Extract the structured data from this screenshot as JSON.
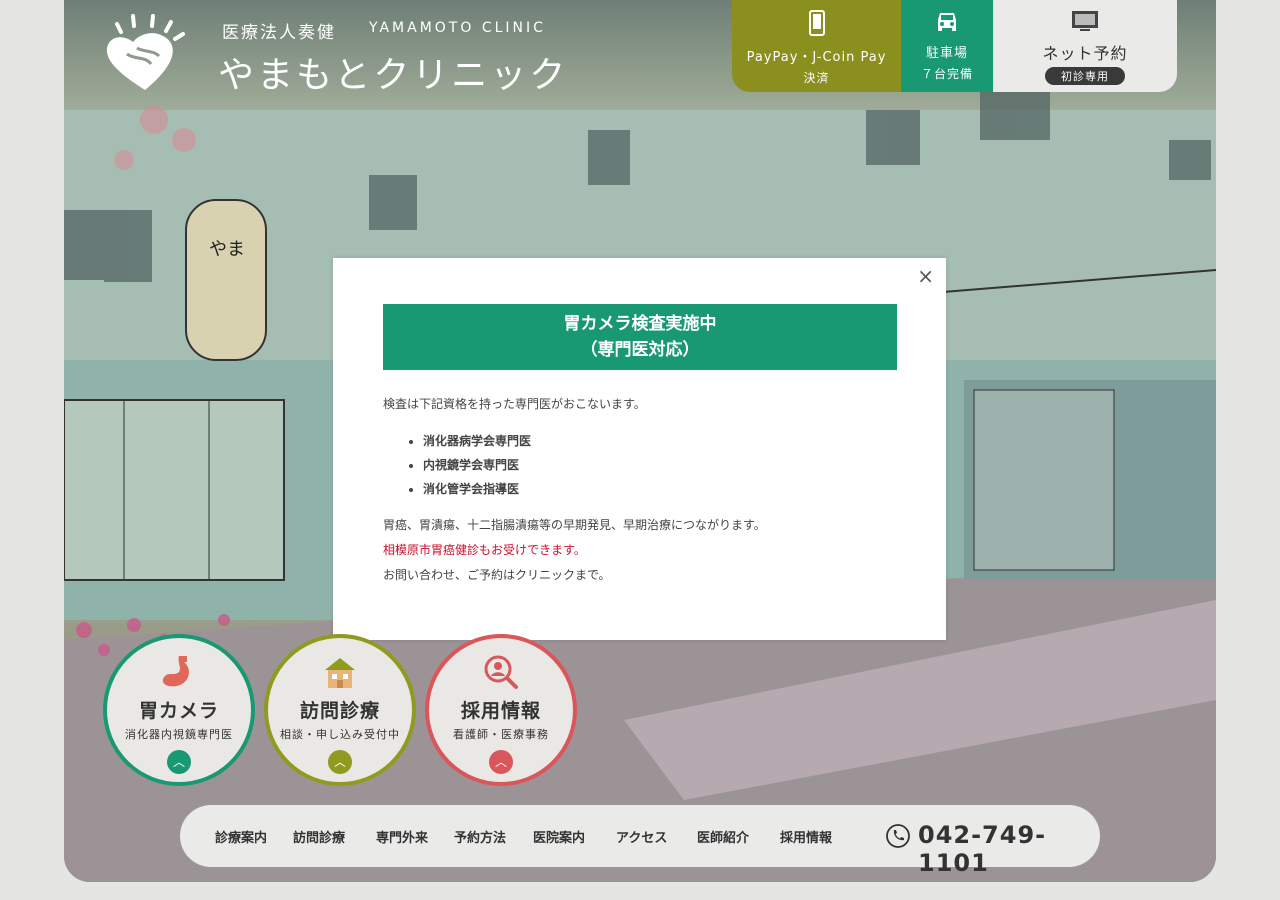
{
  "header": {
    "corp_name": "医療法人奏健",
    "corp_name_en": "YAMAMOTO CLINIC",
    "clinic_name": "やまもとクリニック"
  },
  "top_buttons": {
    "payment": {
      "label": "PayPay・J-Coin Pay",
      "sub": "決済"
    },
    "parking": {
      "label": "駐車場",
      "sub": "７台完備"
    },
    "web_reserve": {
      "label": "ネット予約",
      "badge": "初診専用"
    }
  },
  "modal": {
    "close": "×",
    "title_line1": "胃カメラ検査実施中",
    "title_line2": "（専門医対応）",
    "intro": "検査は下記資格を持った専門医がおこないます。",
    "list": [
      "消化器病学会専門医",
      "内視鏡学会専門医",
      "消化管学会指導医"
    ],
    "line1": "胃癌、胃潰瘍、十二指腸潰瘍等の早期発見、早期治療につながります。",
    "line_red": "相模原市胃癌健診もお受けできます。",
    "line3": "お問い合わせ、ご予約はクリニックまで。"
  },
  "circles": [
    {
      "title": "胃カメラ",
      "sub": "消化器内視鏡専門医",
      "arrow": "︿",
      "color": "#199874"
    },
    {
      "title": "訪問診療",
      "sub": "相談・申し込み受付中",
      "arrow": "︿",
      "color": "#8f9a1e"
    },
    {
      "title": "採用情報",
      "sub": "看護師・医療事務",
      "arrow": "︿",
      "color": "#d9565a"
    }
  ],
  "nav": {
    "items": [
      "診療案内",
      "訪問診療",
      "専門外来",
      "予約方法",
      "医院案内",
      "アクセス",
      "医師紹介",
      "採用情報"
    ],
    "phone": "042-749-1101"
  }
}
